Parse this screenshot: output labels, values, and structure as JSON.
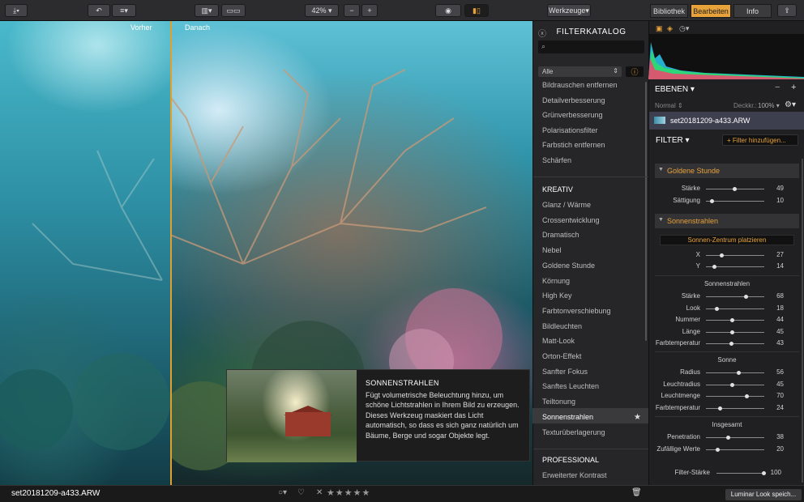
{
  "toolbar": {
    "zoom": "42%",
    "minus": "−",
    "plus": "+",
    "tools_menu": "Werkzeuge",
    "tabs": [
      "Bibliothek",
      "Bearbeiten",
      "Info"
    ]
  },
  "compare": {
    "before": "Vorher",
    "after": "Danach"
  },
  "tooltip": {
    "title": "SONNENSTRAHLEN",
    "text": "Fügt volumetrische Beleuchtung hinzu, um schöne Lichtstrahlen in Ihrem Bild zu erzeugen. Dieses Werkzeug maskiert das Licht automatisch, so dass es sich ganz natürlich um Bäume, Berge und sogar Objekte legt."
  },
  "catalog": {
    "title": "FILTERKATALOG",
    "filter_select": "Alle",
    "items_top": [
      "Bildrauschen entfernen",
      "Detailverbesserung",
      "Grünverbesserung",
      "Polarisationsfilter",
      "Farbstich entfernen",
      "Schärfen"
    ],
    "section_kreativ": "KREATIV",
    "items_kreativ": [
      "Glanz / Wärme",
      "Crossentwicklung",
      "Dramatisch",
      "Nebel",
      "Goldene Stunde",
      "Körnung",
      "High Key",
      "Farbtonverschiebung",
      "Bildleuchten",
      "Matt-Look",
      "Orton-Effekt",
      "Sanfter Fokus",
      "Sanftes Leuchten",
      "Teiltonung",
      "Sonnenstrahlen",
      "Texturüberlagerung"
    ],
    "selected": "Sonnenstrahlen",
    "section_professional": "PROFESSIONAL",
    "items_professional": [
      "Erweiterter Kontrast"
    ]
  },
  "layers": {
    "title": "EBENEN",
    "mode": "Normal",
    "opacity_label": "Deckkr.:",
    "opacity": "100%",
    "layer_name": "set20181209-a433.ARW"
  },
  "filters": {
    "title": "FILTER",
    "add_button": "+ Filter hinzufügen...",
    "golden": {
      "name": "Goldene Stunde",
      "rows": [
        {
          "label": "Stärke",
          "value": 49
        },
        {
          "label": "Sättigung",
          "value": 10
        }
      ]
    },
    "sunrays": {
      "name": "Sonnenstrahlen",
      "place_button": "Sonnen-Zentrum platzieren",
      "pos_rows": [
        {
          "label": "X",
          "value": 27
        },
        {
          "label": "Y",
          "value": 14
        }
      ],
      "group1": "Sonnenstrahlen",
      "rays_rows": [
        {
          "label": "Stärke",
          "value": 68
        },
        {
          "label": "Look",
          "value": 18
        },
        {
          "label": "Nummer",
          "value": 44
        },
        {
          "label": "Länge",
          "value": 45
        },
        {
          "label": "Farbtemperatur",
          "value": 43
        }
      ],
      "group2": "Sonne",
      "sun_rows": [
        {
          "label": "Radius",
          "value": 56
        },
        {
          "label": "Leuchtradius",
          "value": 45
        },
        {
          "label": "Leuchtmenge",
          "value": 70
        },
        {
          "label": "Farbtemperatur",
          "value": 24
        }
      ],
      "group3": "Insgesamt",
      "total_rows": [
        {
          "label": "Penetration",
          "value": 38
        },
        {
          "label": "Zufällige Werte",
          "value": 20
        }
      ]
    },
    "filter_strength": {
      "label": "Filter-Stärke",
      "value": 100
    }
  },
  "bottom": {
    "filename": "set20181209-a433.ARW",
    "stars": "★★★★★",
    "save_look": "Luminar Look speich..."
  },
  "colors": {
    "accent": "#e8a23a"
  }
}
